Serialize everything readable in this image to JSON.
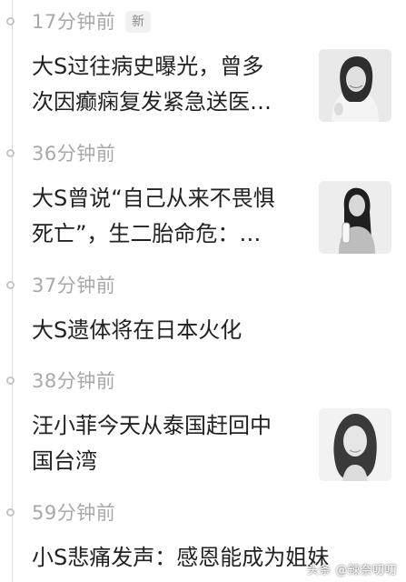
{
  "feed": {
    "items": [
      {
        "time": "17分钟前",
        "badge": "新",
        "title_line1": "大S过往病史曝光，曾多",
        "title_line2": "次因癫痫复发紧急送医…",
        "thumbnail": "photo-woman-smiling"
      },
      {
        "time": "36分钟前",
        "title_line1": "大S曾说“自己从来不畏惧",
        "title_line2": "死亡”，生二胎命危：…",
        "thumbnail": "photo-woman-holding-bottle"
      },
      {
        "time": "37分钟前",
        "title_line1": "大S遗体将在日本火化"
      },
      {
        "time": "38分钟前",
        "title_line1": "汪小菲今天从泰国赶回中",
        "title_line2": "国台湾",
        "thumbnail": "photo-woman-portrait"
      },
      {
        "time": "59分钟前",
        "title_line1": "小S悲痛发声：感恩能成为姐妹"
      }
    ]
  },
  "watermark": "头条 @辣奈叨叨",
  "colors": {
    "time_text": "#a8a8a8",
    "headline_text": "#222222",
    "timeline": "#dedede",
    "badge_bg": "#f1f1f1"
  }
}
